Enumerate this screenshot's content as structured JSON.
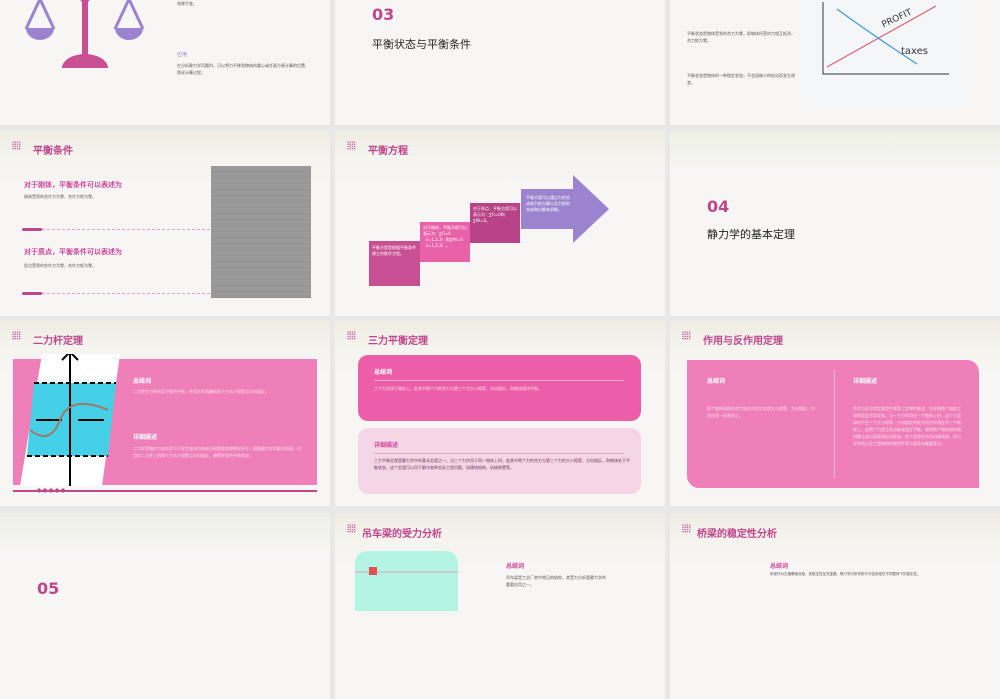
{
  "slides": [
    {
      "id": "balance-application",
      "tail": "效果不变。",
      "heading": "应用",
      "body": "在分析静力学问题时，可以将力平移到物体的重心或任意方便计算的位置，简化计算过程。"
    },
    {
      "id": "section-03",
      "number": "03",
      "title": "平衡状态与平衡条件"
    },
    {
      "id": "equilibrium-state",
      "p1": "平衡状态是物体受到的合力为零，即物体所受的力相互抵消，合力矩为零。",
      "p2": "平衡状态是物体的一种稳定状态，不会因微小的扰动而发生改变。",
      "image_labels": [
        "PROFIT",
        "taxes"
      ]
    },
    {
      "id": "equilibrium-conditions",
      "title": "平衡条件",
      "h1": "对于刚体，平衡条件可以表述为",
      "b1": "刚体受到的合外力为零，合外力矩为零。",
      "h2": "对于质点，平衡条件可以表述为",
      "b2": "质点受到的合外力为零，合外力矩为零。"
    },
    {
      "id": "equilibrium-equations",
      "title": "平衡方程",
      "steps": [
        "平衡方程是根据平衡条件建立的数学方程。",
        "对于刚体，平衡方程可以表示为：∑Fi=0（i=1,2,3）和∑Mi=0（i=1,2,3）。",
        "对于质点，平衡方程可以表示为：∑Fi=0和∑Mi=0。",
        "平衡方程可以通过力的合成和力的分解以及力矩的合成和分解来求解。"
      ]
    },
    {
      "id": "section-04",
      "number": "04",
      "title": "静力学的基本定理"
    },
    {
      "id": "two-force-member",
      "title": "二力杆定理",
      "h1": "总结词",
      "b1": "二力杆在力的作用下保持平衡，作用在杆两端的两个力大小相等且方向相反。",
      "h2": "详细描述",
      "b2": "二力杆是指在力的作用下只发生轴向拉伸或压缩而变的理想化杆件。根据静力学的基本原理，作用在二力杆上的两个力大小相等且方向相反，使得杆保持平衡状态。"
    },
    {
      "id": "three-force",
      "title": "三力平衡定理",
      "h1": "总结词",
      "b1": "三个力作用于物体上，若其中两个力的合力与第三个力大小相等、方向相反，则物体保持平衡。",
      "h2": "详细描述",
      "b2": "三力平衡定理是静力学中的基本定理之一。当三个力作用于同一物体上时，若其中两个力的合力与第三个力的大小相等、方向相反，则物体处于平衡状态。这个定理可以用于解决各种实际工程问题，如建筑结构、机械装置等。"
    },
    {
      "id": "action-reaction",
      "title": "作用与反作用定理",
      "h1": "总结词",
      "b1": "两个物体间的作用力和反作用力总是大小相等、方向相反，作用在同一条直线上。",
      "h2": "详细描述",
      "b2": "作用与反作用定理是牛顿第三定律的表述，它说明两个物体之间的相互作用关系。当一个力作用在一个物体上时，这个力会同时产生一个大小相等、方向相反的反作用力作用在另一个物体上。这两个力相互抵消或者相互平衡，使得两个物体保持相对静止或匀速直线运动状态。这个定理在分析机械系统、动力学系统以及工程结构的稳定性等方面具有重要意义。"
    },
    {
      "id": "section-05",
      "number": "05"
    },
    {
      "id": "crane-beam",
      "title": "吊车梁的受力分析",
      "h1": "总结词",
      "b1": "吊车梁是工业厂房中常见的结构，其受力分析是静力学的重要应用之一。"
    },
    {
      "id": "bridge-stability",
      "title": "桥梁的稳定性分析",
      "h1": "总结词",
      "b1": "桥梁作为交通基础设施，其稳定性至关重要。静力学分析有助于评估桥梁在不同载荷下的稳定性。"
    }
  ],
  "colors": {
    "accent": "#c0468c",
    "pink": "#ef7fb8",
    "hot": "#ec5fa8",
    "purple": "#9b83cf"
  }
}
